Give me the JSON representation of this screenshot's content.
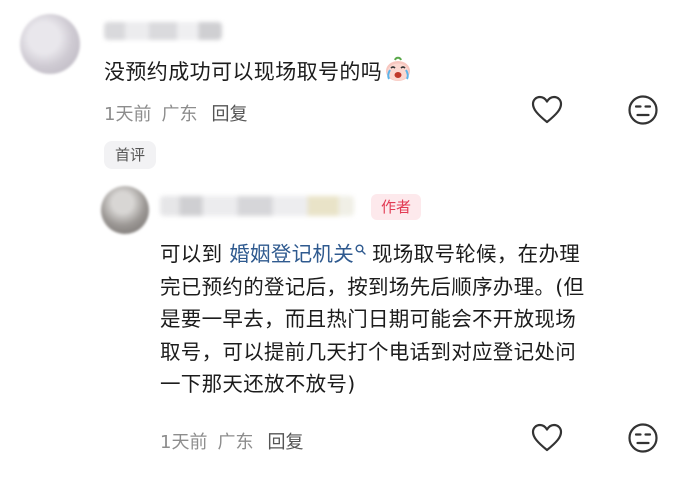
{
  "comment": {
    "text": "没预约成功可以现场取号的吗",
    "emoji": "crying-face-emoji",
    "time": "1天前",
    "location": "广东",
    "reply_label": "回复",
    "tag": "首评"
  },
  "reply": {
    "author_badge": "作者",
    "text_lines": [
      "现场取号轮候，在办理",
      "完已预约的登记后，按到场先后顺序办理。(但",
      "是要一早去，而且热门日期可能会不开放现场",
      "取号，可以提前几天打个电话到对应登记处问",
      "一下那天还放不放号)"
    ],
    "prefix": "可以到",
    "link_text": "婚姻登记机关",
    "time": "1天前",
    "location": "广东",
    "reply_label": "回复"
  },
  "colors": {
    "badge_bg": "#fde9ec",
    "badge_text": "#e23b54",
    "link": "#2f5a8f",
    "meta": "#8d8d8d"
  }
}
